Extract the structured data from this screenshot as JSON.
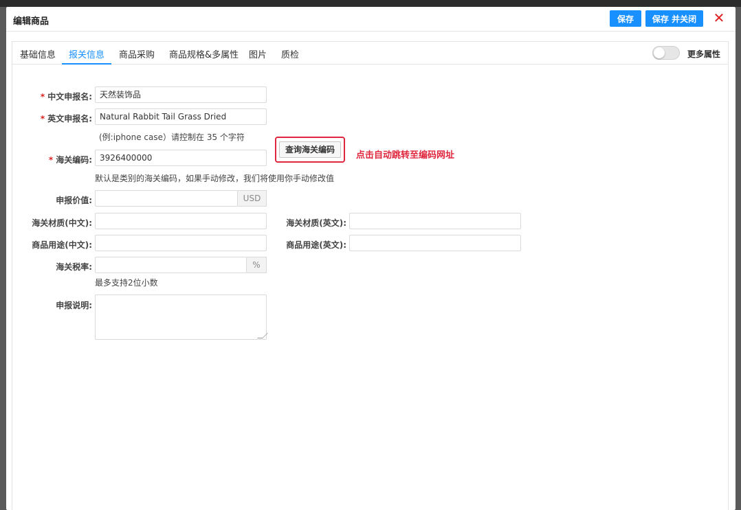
{
  "dialog": {
    "title": "编辑商品",
    "save_label": "保存",
    "save_close_label": "保存 并关闭",
    "close_glyph": "✕"
  },
  "tabs": [
    {
      "label": "基础信息",
      "active": false
    },
    {
      "label": "报关信息",
      "active": true
    },
    {
      "label": "商品采购",
      "active": false
    },
    {
      "label": "商品规格&多属性",
      "active": false
    },
    {
      "label": "图片",
      "active": false
    },
    {
      "label": "质检",
      "active": false
    }
  ],
  "more_attributes": {
    "label": "更多属性",
    "enabled": false
  },
  "form": {
    "cn_name": {
      "required": "*",
      "label": "中文申报名:",
      "value": "天然装饰品"
    },
    "en_name": {
      "required": "*",
      "label": "英文申报名:",
      "value": "Natural Rabbit Tail Grass Dried",
      "hint": "(例:iphone case）请控制在 35 个字符"
    },
    "hs_code": {
      "required": "*",
      "label": "海关编码:",
      "value": "3926400000",
      "button": "查询海关编码",
      "hint": "默认是类别的海关编码，如果手动修改，我们将使用你手动修改值"
    },
    "declared_value": {
      "label": "申报价值:",
      "value": "",
      "unit": "USD"
    },
    "material_cn": {
      "label": "海关材质(中文):",
      "value": ""
    },
    "material_en": {
      "label": "海关材质(英文):",
      "value": ""
    },
    "usage_cn": {
      "label": "商品用途(中文):",
      "value": ""
    },
    "usage_en": {
      "label": "商品用途(英文):",
      "value": ""
    },
    "tax_rate": {
      "label": "海关税率:",
      "value": "",
      "unit": "%",
      "hint": "最多支持2位小数"
    },
    "description": {
      "label": "申报说明:",
      "value": ""
    }
  },
  "annotation": "点击自动跳转至编码网址",
  "colors": {
    "accent": "#1890ff",
    "danger": "#e0263c"
  }
}
